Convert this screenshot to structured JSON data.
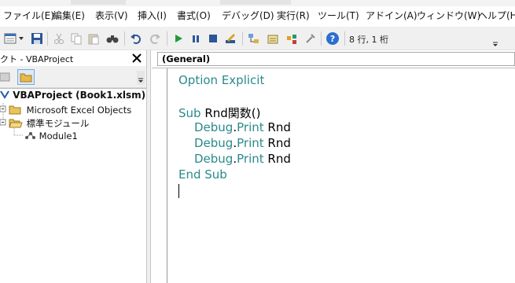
{
  "menu": {
    "items": [
      "ファイル(E)",
      "編集(E)",
      "表示(V)",
      "挿入(I)",
      "書式(O)",
      "デバッグ(D)",
      "実行(R)",
      "ツール(T)",
      "アドイン(A)",
      "ウィンドウ(W)",
      "ヘルプ(H)"
    ]
  },
  "toolbar": {
    "position_text": "8 行, 1 桁"
  },
  "project_panel": {
    "title": "クト - VBAProject",
    "close_glyph": "✕",
    "tree": {
      "project": "VBAProject (Book1.xlsm)",
      "excel_objects": "Microsoft Excel Objects",
      "modules_folder": "標準モジュール",
      "module1": "Module1"
    }
  },
  "code_window": {
    "object_combo": "(General)",
    "lines": {
      "l1_kw": "Option Explicit",
      "l3_kw": "Sub",
      "l3_rest": " Rnd関数()",
      "l4_kw1": "Debug",
      "l4_dot": ".",
      "l4_kw2": "Print",
      "l4_rest": " Rnd",
      "l7_kw": "End Sub"
    }
  },
  "colors": {
    "keyword": "#2a8a8a",
    "toolbar_bg": "#f0f0f0",
    "run_green": "#1f9a3a",
    "help_blue": "#2a6fcf"
  }
}
